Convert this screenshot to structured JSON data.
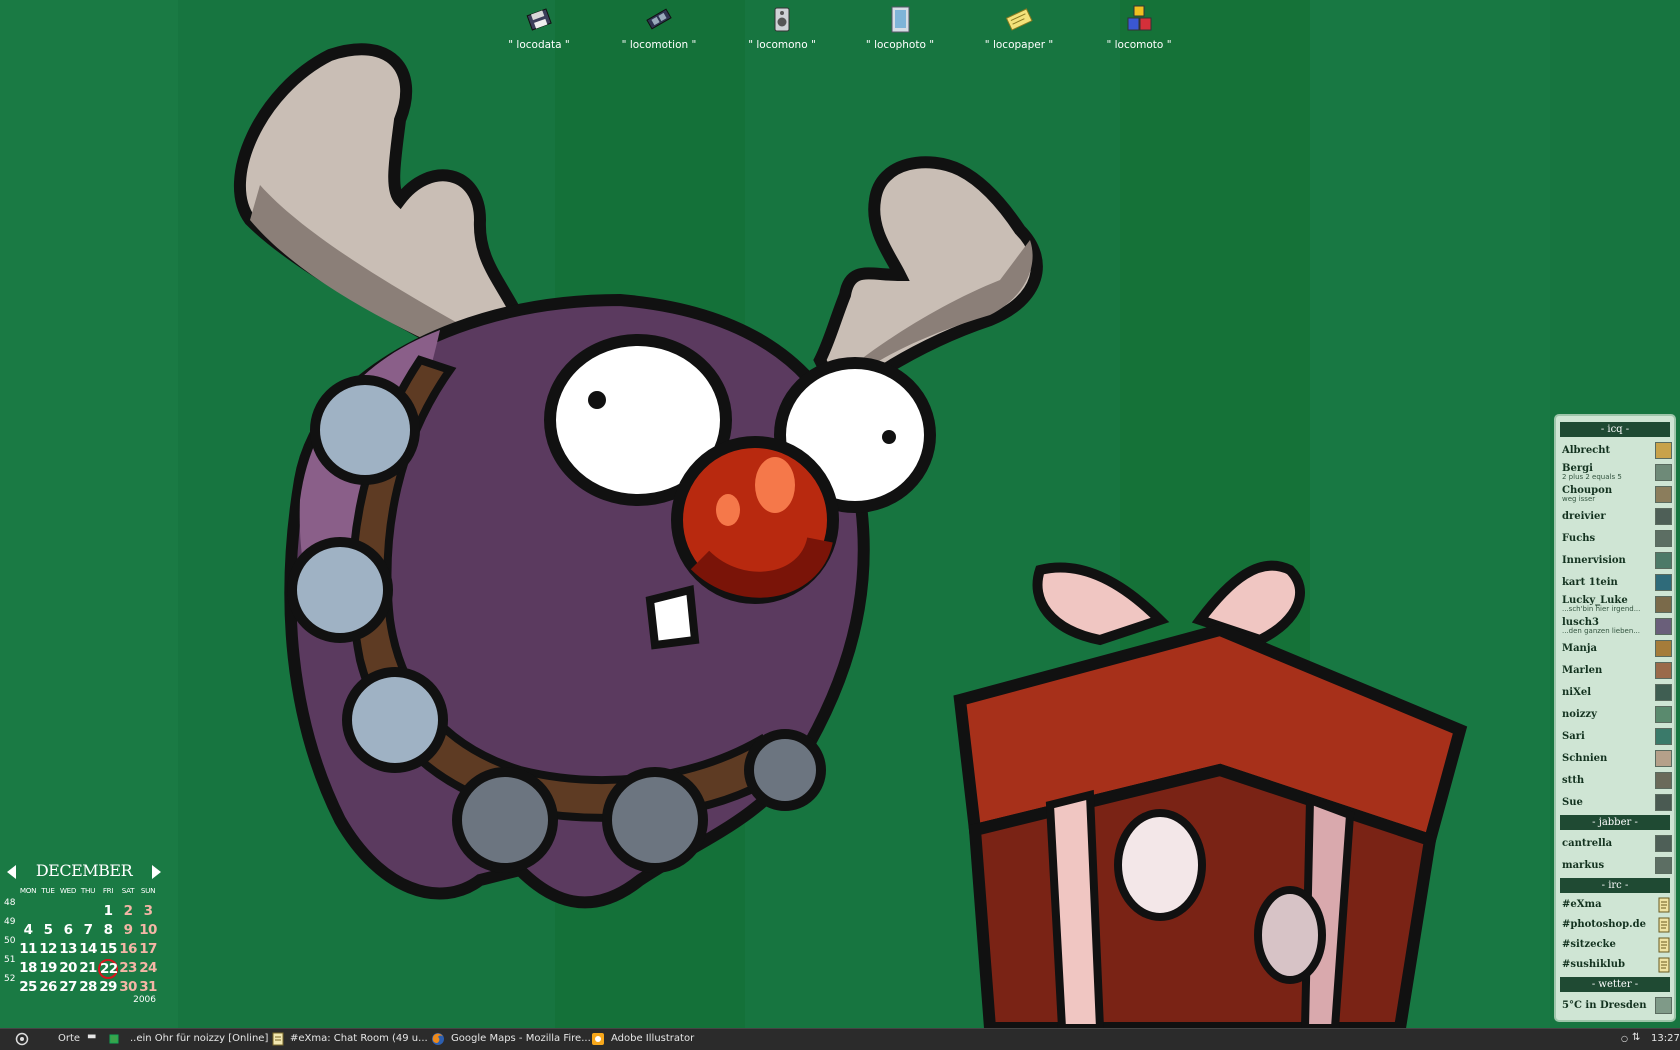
{
  "desktop_icons": [
    {
      "label": "\" locodata \"",
      "icon": "floppy-disk-icon"
    },
    {
      "label": "\" locomotion \"",
      "icon": "film-strip-icon"
    },
    {
      "label": "\" locomono \"",
      "icon": "speaker-icon"
    },
    {
      "label": "\" locophoto \"",
      "icon": "photo-frame-icon"
    },
    {
      "label": "\" locopaper \"",
      "icon": "paper-note-icon"
    },
    {
      "label": "\" locomoto \"",
      "icon": "toy-blocks-icon"
    }
  ],
  "calendar": {
    "month": "DECEMBER",
    "year": "2006",
    "day_headers": [
      "MON",
      "TUE",
      "WED",
      "THU",
      "FRI",
      "SAT",
      "SUN"
    ],
    "week_numbers": [
      "48",
      "49",
      "50",
      "51",
      "52"
    ],
    "weeks": [
      [
        "",
        "",
        "",
        "",
        "1",
        "2",
        "3"
      ],
      [
        "4",
        "5",
        "6",
        "7",
        "8",
        "9",
        "10"
      ],
      [
        "11",
        "12",
        "13",
        "14",
        "15",
        "16",
        "17"
      ],
      [
        "18",
        "19",
        "20",
        "21",
        "22",
        "23",
        "24"
      ],
      [
        "25",
        "26",
        "27",
        "28",
        "29",
        "30",
        "31"
      ]
    ],
    "today": "22",
    "today_color": "#d8141c",
    "weekend_color": "#f4b6a6"
  },
  "buddy_panel": {
    "sections": {
      "icq": "- icq -",
      "jabber": "- jabber -",
      "irc": "- irc -",
      "wetter": "- wetter -"
    },
    "icq": [
      {
        "name": "Albrecht",
        "status": ""
      },
      {
        "name": "Bergi",
        "status": "2 plus 2 equals 5"
      },
      {
        "name": "Choupon",
        "status": "weg isser"
      },
      {
        "name": "dreivier",
        "status": ""
      },
      {
        "name": "Fuchs",
        "status": ""
      },
      {
        "name": "Innervision",
        "status": ""
      },
      {
        "name": "kart 1tein",
        "status": ""
      },
      {
        "name": "Lucky_Luke",
        "status": "...sch'bin hier irgend..."
      },
      {
        "name": "lusch3",
        "status": "...den ganzen lieben..."
      },
      {
        "name": "Manja",
        "status": ""
      },
      {
        "name": "Marlen",
        "status": ""
      },
      {
        "name": "niXel",
        "status": ""
      },
      {
        "name": "noizzy",
        "status": ""
      },
      {
        "name": "Sari",
        "status": ""
      },
      {
        "name": "Schnien",
        "status": ""
      },
      {
        "name": "stth",
        "status": ""
      },
      {
        "name": "Sue",
        "status": ""
      }
    ],
    "jabber": [
      {
        "name": "cantrella",
        "status": ""
      },
      {
        "name": "markus",
        "status": ""
      }
    ],
    "irc": [
      {
        "name": "#eXma"
      },
      {
        "name": "#photoshop.de"
      },
      {
        "name": "#sitzecke"
      },
      {
        "name": "#sushiklub"
      }
    ],
    "wetter": {
      "text": "5°C in Dresden"
    }
  },
  "taskbar": {
    "places_label": "Orte",
    "tasks": [
      {
        "label": "..ein Ohr für noizzy [Online]",
        "icon": "chat-status-icon"
      },
      {
        "label": "#eXma: Chat Room (49 u...",
        "icon": "scroll-icon"
      },
      {
        "label": "Google Maps - Mozilla Fire...",
        "icon": "firefox-icon"
      },
      {
        "label": "Adobe Illustrator",
        "icon": "illustrator-icon"
      }
    ],
    "clock": "13:27"
  },
  "colors": {
    "desktop_bg": "#177540",
    "panel_bg": "#cfe5d4",
    "section_bg": "#1f4a33",
    "taskbar_bg": "#2b2b2b"
  }
}
